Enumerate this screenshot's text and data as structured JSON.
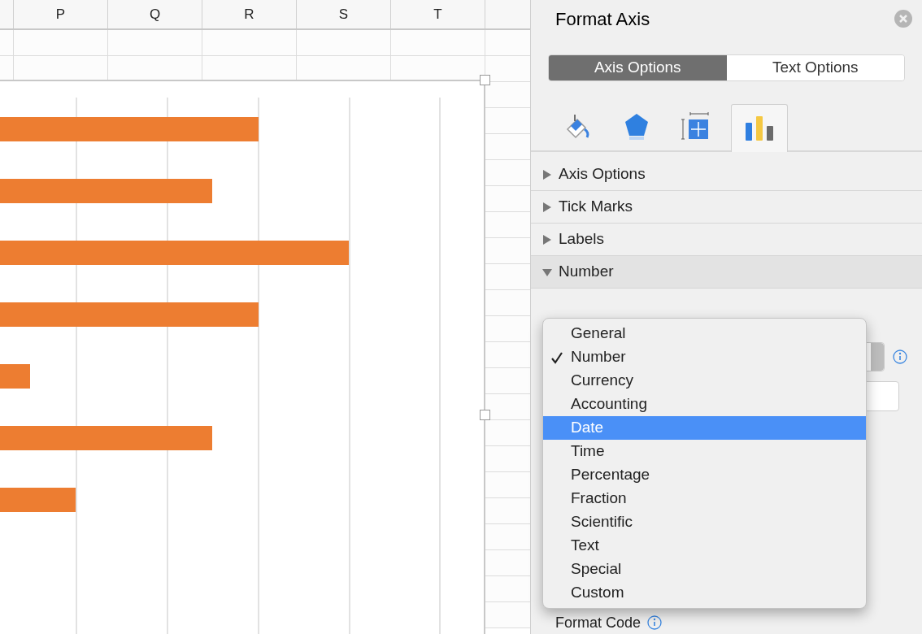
{
  "sheet": {
    "columns": [
      "P",
      "Q",
      "R",
      "S",
      "T"
    ]
  },
  "panel": {
    "title": "Format Axis",
    "tabs": [
      {
        "label": "Axis Options",
        "selected": true
      },
      {
        "label": "Text Options",
        "selected": false
      }
    ],
    "icon_tabs": [
      {
        "kind": "fill",
        "selected": false
      },
      {
        "kind": "effects",
        "selected": false
      },
      {
        "kind": "size",
        "selected": false
      },
      {
        "kind": "options",
        "selected": true
      }
    ],
    "sections": [
      {
        "label": "Axis Options",
        "expanded": false
      },
      {
        "label": "Tick Marks",
        "expanded": false
      },
      {
        "label": "Labels",
        "expanded": false
      },
      {
        "label": "Number",
        "expanded": true
      }
    ],
    "format_code": {
      "label": "Format Code"
    },
    "category_menu": {
      "items": [
        {
          "label": "General",
          "checked": false,
          "selected": false
        },
        {
          "label": "Number",
          "checked": true,
          "selected": false
        },
        {
          "label": "Currency",
          "checked": false,
          "selected": false
        },
        {
          "label": "Accounting",
          "checked": false,
          "selected": false
        },
        {
          "label": "Date",
          "checked": false,
          "selected": true
        },
        {
          "label": "Time",
          "checked": false,
          "selected": false
        },
        {
          "label": "Percentage",
          "checked": false,
          "selected": false
        },
        {
          "label": "Fraction",
          "checked": false,
          "selected": false
        },
        {
          "label": "Scientific",
          "checked": false,
          "selected": false
        },
        {
          "label": "Text",
          "checked": false,
          "selected": false
        },
        {
          "label": "Special",
          "checked": false,
          "selected": false
        },
        {
          "label": "Custom",
          "checked": false,
          "selected": false
        }
      ]
    }
  }
}
